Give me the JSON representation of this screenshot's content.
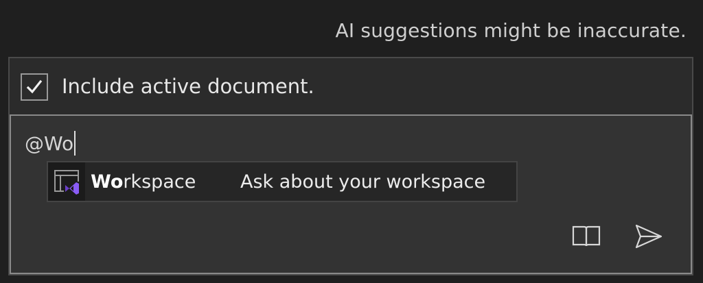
{
  "disclaimer": "AI suggestions might be inaccurate.",
  "include": {
    "label": "Include active document.",
    "checked": true
  },
  "input": {
    "value": "@Wo"
  },
  "suggestion": {
    "icon": "visual-studio-workspace-icon",
    "name_match": "Wo",
    "name_rest": "rkspace",
    "description": "Ask about your workspace"
  },
  "actions": {
    "reference_icon": "book-icon",
    "send_icon": "send-icon"
  },
  "colors": {
    "background": "#1f1f1f",
    "panel": "#2b2b2b",
    "input": "#333333",
    "vs_purple": "#8a5cf6"
  }
}
